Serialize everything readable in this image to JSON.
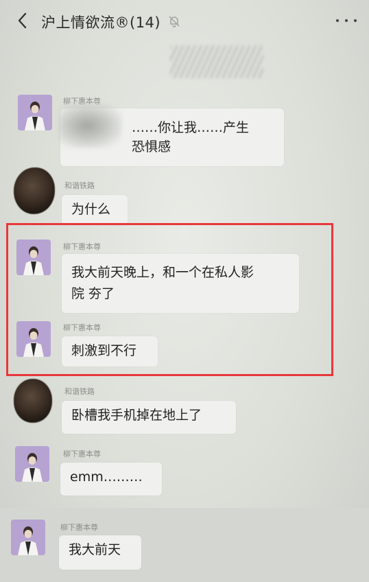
{
  "header": {
    "title": "沪上情欲流®(14)",
    "back_icon": "chevron-left-icon",
    "mute_icon": "bell-mute-icon",
    "more_icon": "more-dots-icon"
  },
  "messages": [
    {
      "sender": "柳下惠本尊",
      "text_line1": "……你让我……产生",
      "text_line2": "恐惧感"
    },
    {
      "sender": "和谐铁路",
      "text": "为什么"
    },
    {
      "sender": "柳下惠本尊",
      "text_line1": "我大前天晚上，和一个在私人影",
      "text_line2": "院 夯了"
    },
    {
      "sender": "柳下惠本尊",
      "text": "刺激到不行"
    },
    {
      "sender": "和谐铁路",
      "text": "卧槽我手机掉在地上了"
    },
    {
      "sender": "柳下惠本尊",
      "text": "emm………"
    },
    {
      "sender": "柳下惠本尊",
      "text": "我大前天"
    }
  ],
  "colors": {
    "highlight_border": "#e8373c",
    "bubble_bg": "#f0f1ee",
    "chat_bg": "#e3e5e0"
  }
}
